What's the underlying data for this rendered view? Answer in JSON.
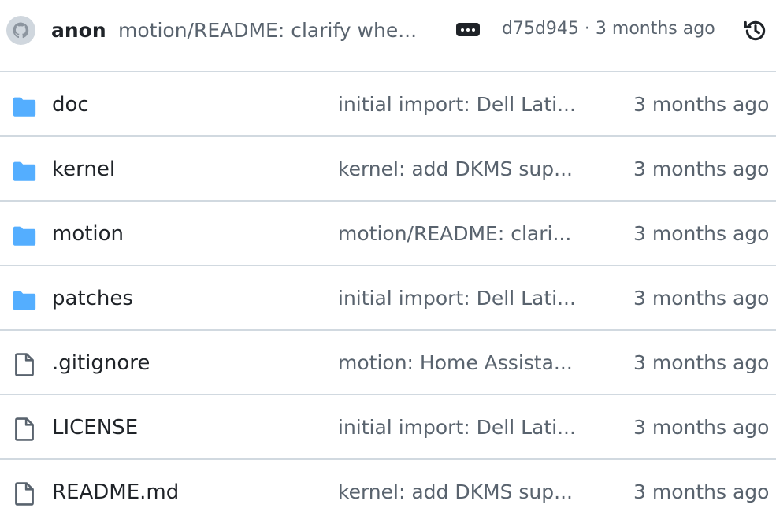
{
  "header": {
    "author": "anon",
    "commit_message": "motion/README: clarify whe...",
    "sha_age": "d75d945 · 3 months ago",
    "avatar_icon": "github-octocat-icon",
    "more_icon": "kebab-horizontal-icon",
    "history_icon": "history-icon"
  },
  "colors": {
    "folder": "#54aeff",
    "muted": "#59636e",
    "text": "#1f2328",
    "border": "#d1d9e0"
  },
  "files": [
    {
      "type": "folder",
      "name": "doc",
      "message": "initial import: Dell Lati...",
      "age": "3 months ago"
    },
    {
      "type": "folder",
      "name": "kernel",
      "message": "kernel: add DKMS sup...",
      "age": "3 months ago"
    },
    {
      "type": "folder",
      "name": "motion",
      "message": "motion/README: clari...",
      "age": "3 months ago"
    },
    {
      "type": "folder",
      "name": "patches",
      "message": "initial import: Dell Lati...",
      "age": "3 months ago"
    },
    {
      "type": "file",
      "name": ".gitignore",
      "message": "motion: Home Assista...",
      "age": "3 months ago"
    },
    {
      "type": "file",
      "name": "LICENSE",
      "message": "initial import: Dell Lati...",
      "age": "3 months ago"
    },
    {
      "type": "file",
      "name": "README.md",
      "message": "kernel: add DKMS sup...",
      "age": "3 months ago"
    }
  ]
}
